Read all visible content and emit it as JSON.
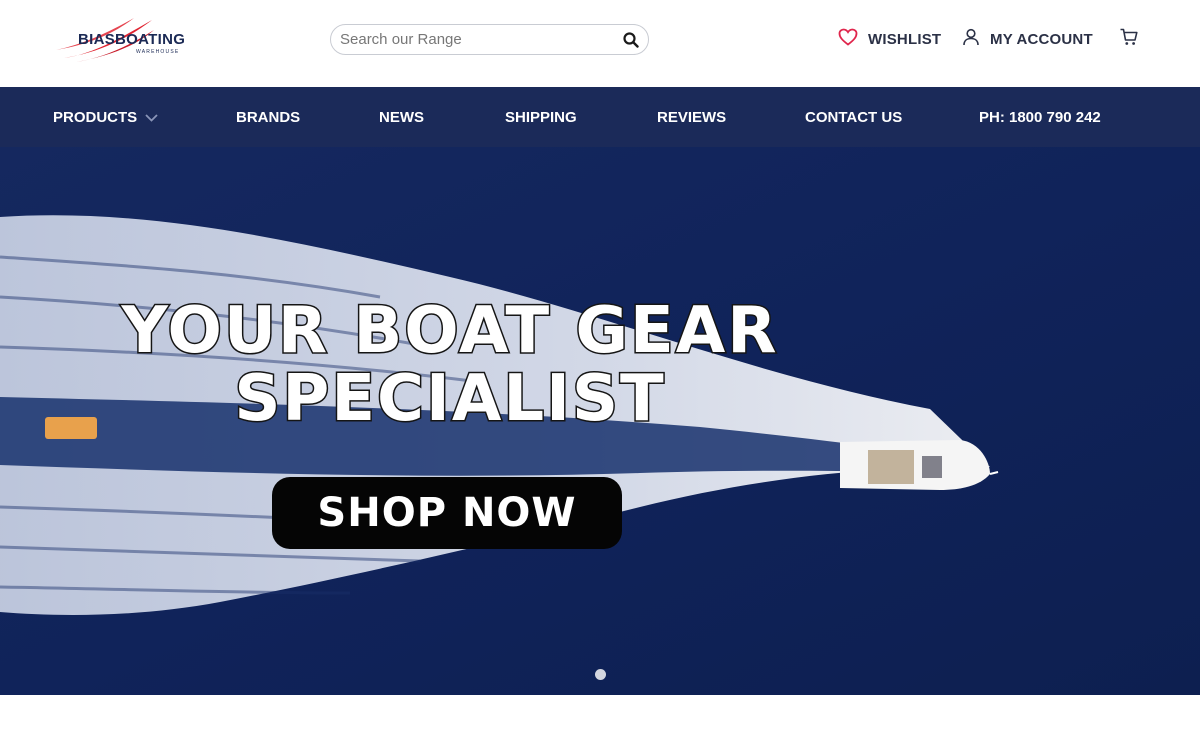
{
  "brand": {
    "logo_text": "BIASBOATING",
    "logo_sub": "WAREHOUSE",
    "logo_colors": {
      "red": "#e02431",
      "navy": "#1b2a55"
    }
  },
  "search": {
    "placeholder": "Search our Range",
    "value": "",
    "icon": "search-icon"
  },
  "header_links": {
    "wishlist": {
      "label": "WISHLIST",
      "icon": "heart-icon",
      "icon_color": "#e0254c"
    },
    "account": {
      "label": "MY ACCOUNT",
      "icon": "user-icon"
    },
    "cart": {
      "icon": "cart-icon"
    }
  },
  "nav": {
    "background": "#1b2a59",
    "items": [
      {
        "label": "PRODUCTS",
        "has_dropdown": true
      },
      {
        "label": "BRANDS"
      },
      {
        "label": "NEWS"
      },
      {
        "label": "SHIPPING"
      },
      {
        "label": "REVIEWS"
      },
      {
        "label": "CONTACT US"
      },
      {
        "label": "PH: 1800 790 242"
      }
    ]
  },
  "hero": {
    "title_line1": "YOUR BOAT GEAR",
    "title_line2": "SPECIALIST",
    "cta_label": "SHOP NOW",
    "slide_count": 1,
    "active_slide": 1,
    "accent": "#e8a14c"
  }
}
